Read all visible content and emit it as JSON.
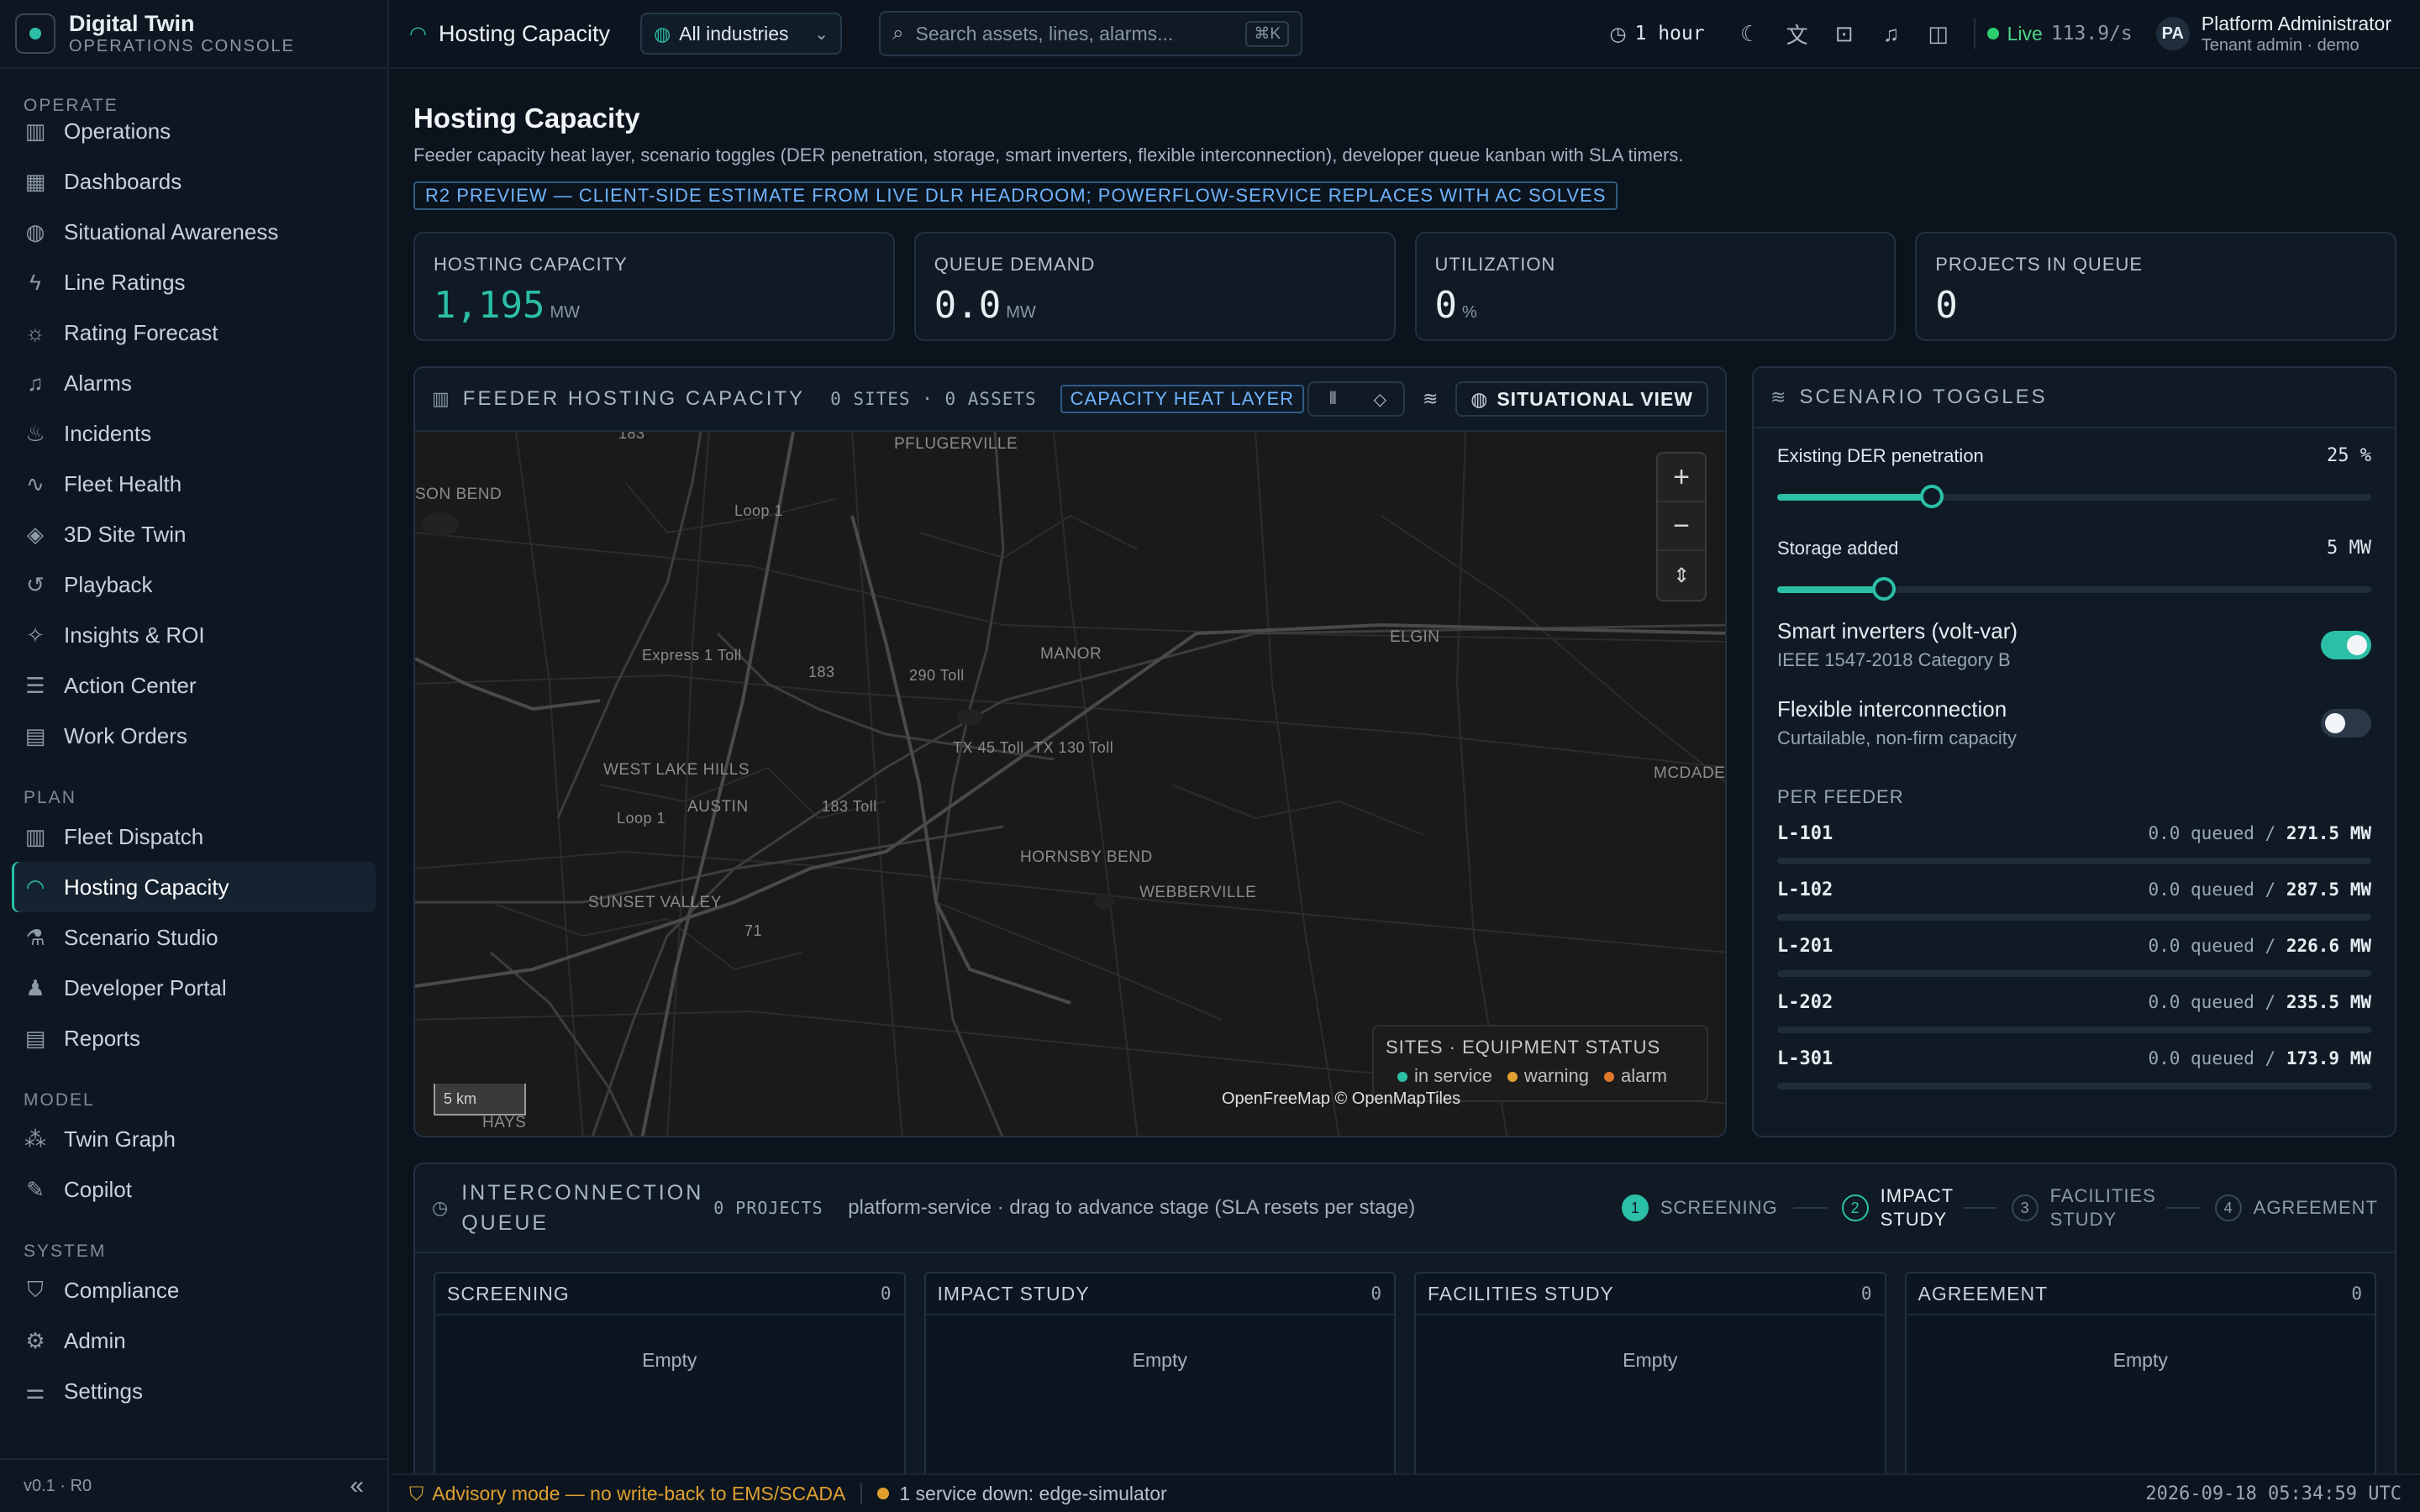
{
  "brand": {
    "title": "Digital Twin",
    "subtitle": "OPERATIONS CONSOLE"
  },
  "sidebar": {
    "sections": [
      {
        "label": "OPERATE",
        "items": [
          {
            "label": "Operations",
            "icon": "map-icon"
          },
          {
            "label": "Dashboards",
            "icon": "grid-icon"
          },
          {
            "label": "Situational Awareness",
            "icon": "globe-icon"
          },
          {
            "label": "Line Ratings",
            "icon": "bolt-icon"
          },
          {
            "label": "Rating Forecast",
            "icon": "cloud-sun-icon"
          },
          {
            "label": "Alarms",
            "icon": "bell-icon"
          },
          {
            "label": "Incidents",
            "icon": "flame-icon"
          },
          {
            "label": "Fleet Health",
            "icon": "pulse-icon"
          },
          {
            "label": "3D Site Twin",
            "icon": "cube-icon"
          },
          {
            "label": "Playback",
            "icon": "history-icon"
          },
          {
            "label": "Insights & ROI",
            "icon": "lightbulb-icon"
          },
          {
            "label": "Action Center",
            "icon": "list-check-icon"
          },
          {
            "label": "Work Orders",
            "icon": "clipboard-icon"
          }
        ]
      },
      {
        "label": "PLAN",
        "items": [
          {
            "label": "Fleet Dispatch",
            "icon": "bar-chart-icon"
          },
          {
            "label": "Hosting Capacity",
            "icon": "gauge-icon",
            "active": true
          },
          {
            "label": "Scenario Studio",
            "icon": "flask-icon"
          },
          {
            "label": "Developer Portal",
            "icon": "users-icon"
          },
          {
            "label": "Reports",
            "icon": "report-icon"
          }
        ]
      },
      {
        "label": "MODEL",
        "items": [
          {
            "label": "Twin Graph",
            "icon": "network-icon"
          },
          {
            "label": "Copilot",
            "icon": "chat-icon"
          }
        ]
      },
      {
        "label": "SYSTEM",
        "items": [
          {
            "label": "Compliance",
            "icon": "shield-icon"
          },
          {
            "label": "Admin",
            "icon": "gear-icon"
          },
          {
            "label": "Settings",
            "icon": "sliders-icon"
          }
        ]
      }
    ],
    "version": "v0.1 · R0"
  },
  "topbar": {
    "page": "Hosting Capacity",
    "industry": "All industries",
    "search_placeholder": "Search assets, lines, alarms...",
    "search_shortcut": "⌘K",
    "time_range": "1 hour",
    "live_label": "Live",
    "live_rate": "113.9/s",
    "user_initials": "PA",
    "user_name": "Platform Administrator",
    "user_role": "Tenant admin · demo"
  },
  "header": {
    "title": "Hosting Capacity",
    "subtitle": "Feeder capacity heat layer, scenario toggles (DER penetration, storage, smart inverters, flexible interconnection), developer queue kanban with SLA timers.",
    "preview_tag": "R2 PREVIEW — CLIENT-SIDE ESTIMATE FROM LIVE DLR HEADROOM; POWERFLOW-SERVICE REPLACES WITH AC SOLVES"
  },
  "kpis": [
    {
      "label": "HOSTING CAPACITY",
      "value": "1,195",
      "unit": "MW",
      "accent": true
    },
    {
      "label": "QUEUE DEMAND",
      "value": "0.0",
      "unit": "MW"
    },
    {
      "label": "UTILIZATION",
      "value": "0",
      "unit": "%"
    },
    {
      "label": "PROJECTS IN QUEUE",
      "value": "0",
      "unit": ""
    }
  ],
  "map_panel": {
    "title": "FEEDER HOSTING CAPACITY",
    "meta": "0 SITES · 0 ASSETS",
    "heat_tag": "CAPACITY HEAT LAYER",
    "situational_view": "SITUATIONAL VIEW",
    "labels": {
      "l1": "183",
      "l2": "PFLUGERVILLE",
      "l3": "SON BEND",
      "l4": "Loop 1",
      "l5": "ELGIN",
      "l6": "Express 1 Toll",
      "l7": "183",
      "l8": "290 Toll",
      "l9": "MANOR",
      "l10": "TX 45 Toll",
      "l11": "TX 130 Toll",
      "l12": "WEST LAKE HILLS",
      "l13": "AUSTIN",
      "l14": "183 Toll",
      "l15": "Loop 1",
      "l16": "MCDADE",
      "l17": "HORNSBY BEND",
      "l18": "WEBBERVILLE",
      "l19": "SUNSET VALLEY",
      "l20": "71",
      "l21": "HAYS"
    },
    "legend_title": "SITES · EQUIPMENT STATUS",
    "legend": [
      {
        "label": "in service",
        "color": "#2bbfa6"
      },
      {
        "label": "warning",
        "color": "#e0a030"
      },
      {
        "label": "alarm",
        "color": "#e0782a"
      }
    ],
    "scale": "5 km",
    "attribution": "OpenFreeMap © OpenMapTiles"
  },
  "scenario": {
    "title": "SCENARIO TOGGLES",
    "der_label": "Existing DER penetration",
    "der_value": "25 %",
    "der_fraction": 0.26,
    "storage_label": "Storage added",
    "storage_value": "5 MW",
    "storage_fraction": 0.18,
    "smart_title": "Smart inverters (volt-var)",
    "smart_sub": "IEEE 1547-2018 Category B",
    "smart_on": true,
    "flex_title": "Flexible interconnection",
    "flex_sub": "Curtailable, non-firm capacity",
    "flex_on": false,
    "per_feeder_title": "PER FEEDER",
    "feeders": [
      {
        "name": "L-101",
        "queued": "0.0 queued /",
        "cap": "271.5 MW"
      },
      {
        "name": "L-102",
        "queued": "0.0 queued /",
        "cap": "287.5 MW"
      },
      {
        "name": "L-201",
        "queued": "0.0 queued /",
        "cap": "226.6 MW"
      },
      {
        "name": "L-202",
        "queued": "0.0 queued /",
        "cap": "235.5 MW"
      },
      {
        "name": "L-301",
        "queued": "0.0 queued /",
        "cap": "173.9 MW"
      }
    ]
  },
  "queue": {
    "title": "INTERCONNECTION QUEUE",
    "count": "0 PROJECTS",
    "desc": "platform-service · drag to advance stage (SLA resets per stage)",
    "stages": [
      {
        "num": "1",
        "label": "SCREENING",
        "state": "done"
      },
      {
        "num": "2",
        "label": "IMPACT STUDY",
        "state": "current"
      },
      {
        "num": "3",
        "label": "FACILITIES STUDY",
        "state": "todo"
      },
      {
        "num": "4",
        "label": "AGREEMENT",
        "state": "todo"
      }
    ],
    "columns": [
      {
        "title": "SCREENING",
        "count": "0",
        "empty": "Empty"
      },
      {
        "title": "IMPACT STUDY",
        "count": "0",
        "empty": "Empty"
      },
      {
        "title": "FACILITIES STUDY",
        "count": "0",
        "empty": "Empty"
      },
      {
        "title": "AGREEMENT",
        "count": "0",
        "empty": "Empty"
      }
    ]
  },
  "statusbar": {
    "advisory": "Advisory mode — no write-back to EMS/SCADA",
    "service": "1 service down: edge-simulator",
    "clock": "2026-09-18 05:34:59 UTC"
  }
}
